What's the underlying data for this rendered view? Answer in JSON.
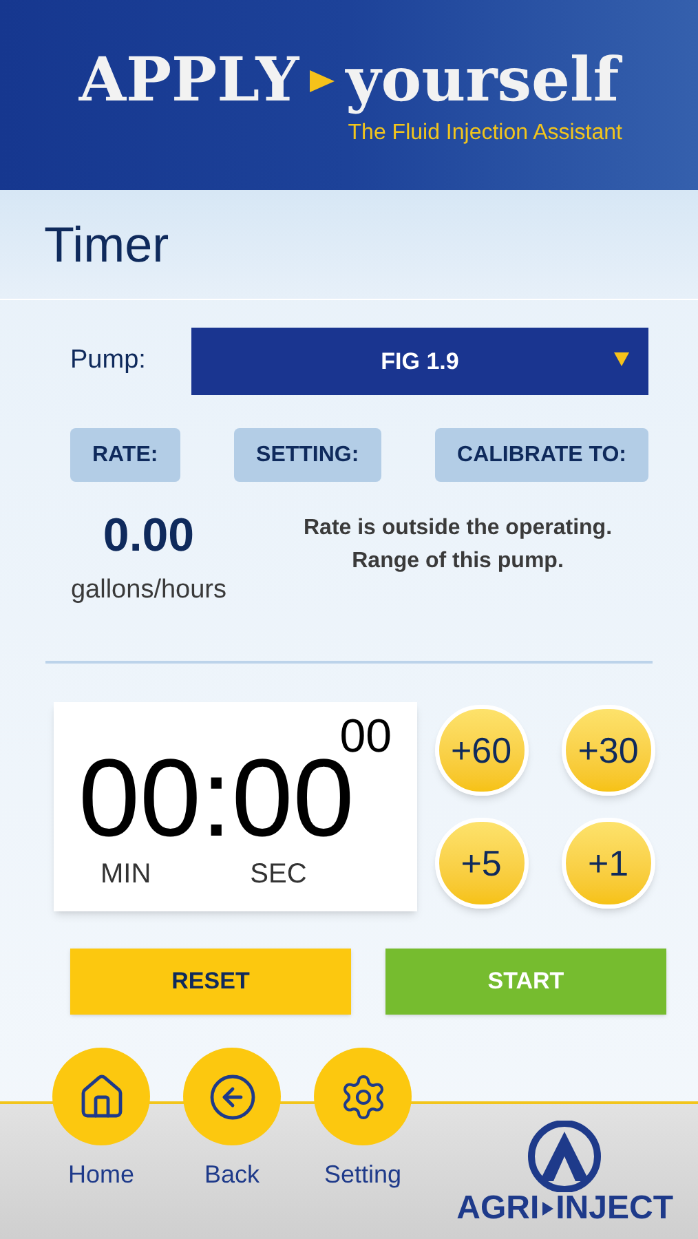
{
  "header": {
    "brand_left": "APPLY",
    "brand_right": "yourself",
    "tagline": "The Fluid Injection Assistant"
  },
  "page_title": "Timer",
  "pump": {
    "label": "Pump:",
    "value": "FIG 1.9"
  },
  "info_tabs": [
    {
      "label": "RATE:"
    },
    {
      "label": "SETTING:"
    },
    {
      "label": "CALIBRATE TO:"
    }
  ],
  "rate": {
    "value": "0.00",
    "unit": "gallons/hours"
  },
  "message": "Rate is outside the operating. Range of this pump.",
  "timer": {
    "display": "00:00",
    "hundredths": "00",
    "min_label": "MIN",
    "sec_label": "SEC"
  },
  "add_buttons": [
    "+60",
    "+30",
    "+5",
    "+1"
  ],
  "actions": [
    {
      "kind": "reset",
      "label": "RESET"
    },
    {
      "kind": "start",
      "label": "START"
    }
  ],
  "nav": [
    {
      "kind": "home",
      "label": "Home"
    },
    {
      "kind": "back",
      "label": "Back"
    },
    {
      "kind": "setting",
      "label": "Setting"
    }
  ],
  "footer_logo": {
    "left": "AGRI",
    "right": "INJECT"
  }
}
